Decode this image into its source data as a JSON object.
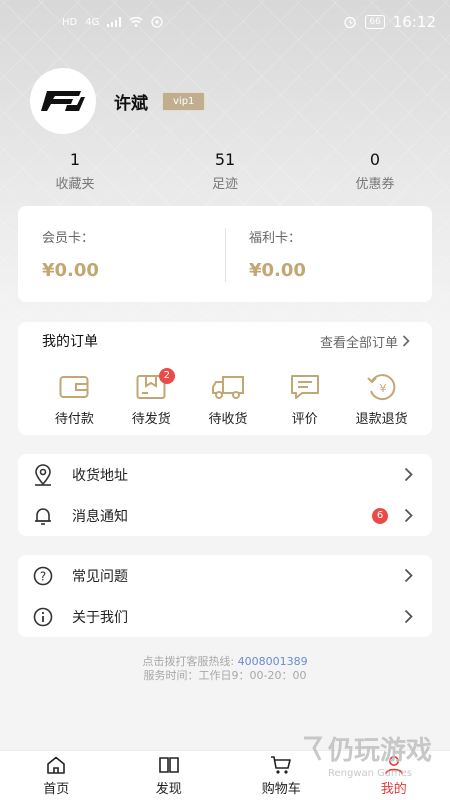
{
  "status_bar": {
    "network_left": "HD",
    "signal_text": "4G",
    "battery": "66",
    "time": "16:12"
  },
  "profile": {
    "name": "许斌",
    "vip": "vip1"
  },
  "stats": [
    {
      "num": "1",
      "label": "收藏夹"
    },
    {
      "num": "51",
      "label": "足迹"
    },
    {
      "num": "0",
      "label": "优惠券"
    }
  ],
  "wallet": {
    "member_label": "会员卡：",
    "member_amount": "¥0.00",
    "welfare_label": "福利卡：",
    "welfare_amount": "¥0.00"
  },
  "orders": {
    "title": "我的订单",
    "view_all": "查看全部订单",
    "items": [
      {
        "label": "待付款",
        "icon": "wallet-icon"
      },
      {
        "label": "待发货",
        "icon": "package-icon",
        "badge": "2"
      },
      {
        "label": "待收货",
        "icon": "truck-icon"
      },
      {
        "label": "评价",
        "icon": "comment-icon"
      },
      {
        "label": "退款退货",
        "icon": "refund-icon"
      }
    ]
  },
  "menu1": [
    {
      "label": "收货地址",
      "icon": "location-icon"
    },
    {
      "label": "消息通知",
      "icon": "bell-icon",
      "badge": "6"
    }
  ],
  "menu2": [
    {
      "label": "常见问题",
      "icon": "question-icon"
    },
    {
      "label": "关于我们",
      "icon": "info-icon"
    }
  ],
  "hotline": {
    "prefix": "点击拨打客服热线:",
    "phone": "4008001389",
    "hours": "服务时间：工作日9：00-20：00"
  },
  "nav": [
    {
      "label": "首页",
      "icon": "home-icon"
    },
    {
      "label": "发现",
      "icon": "book-icon"
    },
    {
      "label": "购物车",
      "icon": "cart-icon"
    },
    {
      "label": "我的",
      "icon": "user-icon",
      "active": true
    }
  ],
  "watermark": {
    "big": "仍玩游戏",
    "small": "Rengwan Games"
  },
  "colors": {
    "gold": "#c2a773",
    "accent_red": "#e23a3a",
    "badge_red": "#e94b4b"
  }
}
